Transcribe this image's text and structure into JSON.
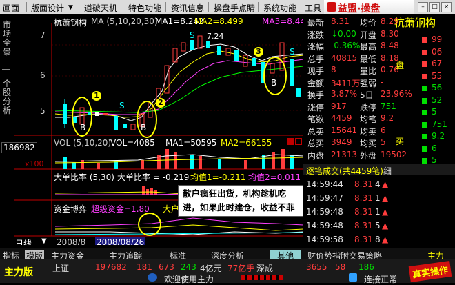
{
  "menu": {
    "items": [
      "画面",
      "版面设计",
      "道破天机",
      "特色功能",
      "资讯信息",
      "操盘手点睛",
      "系统功能",
      "工具"
    ],
    "brand": "益盟·操盘"
  },
  "left_strip": {
    "label1": "市场全景",
    "label2": "个股分析"
  },
  "chart": {
    "header": {
      "stock_name": "杭萧钢构",
      "ma_label": "MA (5,10,20,30)",
      "ma1": "MA1=8.242",
      "ma2": "MA2=8.499",
      "ma3": "MA3=8.449",
      "price_note": "7.24"
    },
    "y_ticks": [
      "7",
      "6",
      "5"
    ],
    "volume": {
      "left_value": "186982",
      "label": "VOL (5,10,20)",
      "vol": "VOL=4085",
      "ma1": "MA1=50595",
      "ma2": "MA2=66155",
      "scale": "x100"
    },
    "bigorder": {
      "label": "大单比率 (5,30)",
      "value": "大单比率 = -0.219",
      "ma1": "均值1=-0.211",
      "ma2": "均值2=0.011"
    },
    "capital": {
      "label": "资金博弈",
      "super": "超级资金=1.80",
      "big": "大户"
    },
    "dates": [
      "2008/8",
      "2008/08/26"
    ],
    "bottom_left": "日线",
    "badges": [
      "1",
      "2",
      "3"
    ],
    "letters": {
      "b": "B",
      "s": "S"
    }
  },
  "popup": {
    "line1": "散户疯狂出货，机构趁机吃",
    "line2": "进，如果此时建仓，收益不菲"
  },
  "right_panel": {
    "title": "杭萧钢构",
    "quotes": [
      {
        "l1": "最新",
        "v1": "8.31",
        "l2": "均价",
        "v2": "8.29"
      },
      {
        "l1": "涨跌",
        "v1": "↓0.00",
        "l2": "开盘",
        "v2": "8.30"
      },
      {
        "l1": "涨幅",
        "v1": "-0.36%",
        "l2": "最高",
        "v2": "8.48"
      },
      {
        "l1": "总手",
        "v1": "40815",
        "l2": "最低",
        "v2": "8.18"
      },
      {
        "l1": "现手",
        "v1": "8",
        "l2": "量比",
        "v2": "0.76"
      },
      {
        "l1": "金额",
        "v1": "3411万",
        "l2": "强弱",
        "v2": "-"
      },
      {
        "l1": "换手",
        "v1": "3.87%",
        "l2": "5日",
        "v2": "23.96%"
      },
      {
        "l1": "涨停",
        "v1": "917",
        "l2": "跌停",
        "v2": "751"
      },
      {
        "l1": "笔数",
        "v1": "4459",
        "l2": "均笔",
        "v2": "9.2"
      },
      {
        "l1": "总卖",
        "v1": "15641",
        "l2": "均卖",
        "v2": "6"
      },
      {
        "l1": "总买",
        "v1": "3949",
        "l2": "均买",
        "v2": "5"
      },
      {
        "l1": "内盘",
        "v1": "21313",
        "l2": "外盘",
        "v2": "19502"
      }
    ],
    "right_column": [
      "99",
      "06",
      "67",
      "55",
      "56",
      "52",
      "5",
      "751",
      "9.2",
      "6",
      "5"
    ],
    "side_labels": [
      "盘",
      "买"
    ],
    "trades_header": "逐笔成交(共4459笔)",
    "trades_tab": "细",
    "trades": [
      {
        "time": "14:59:44",
        "price": "8.31",
        "vol": "4"
      },
      {
        "time": "14:59:47",
        "price": "8.31",
        "vol": "1"
      },
      {
        "time": "14:59:48",
        "price": "8.31",
        "vol": "1"
      },
      {
        "time": "14:59:48",
        "price": "8.31",
        "vol": "5"
      },
      {
        "time": "14:59:58",
        "price": "8.31",
        "vol": "8"
      }
    ]
  },
  "tabs": [
    "指标",
    "模版",
    "主力资金",
    "主力追踪",
    "标准",
    "深度分析",
    "其他",
    "财价势指附交易策略",
    "主力"
  ],
  "status": {
    "app_name": "主力版",
    "index_name": "上证",
    "index_value": "197682",
    "up": "181",
    "flat": "673",
    "down": "243",
    "amount": "4亿元",
    "amount2": "77亿手",
    "market": "深成",
    "v1": "3655",
    "v2": "58",
    "v3": "186",
    "welcome": "欢迎使用主力",
    "connect": "连接正常",
    "watermark": "真实操作"
  },
  "colors": {
    "up": "#ff3c3c",
    "down": "#00e000",
    "accent": "#ffff00",
    "menu": "#dcdcdc"
  }
}
